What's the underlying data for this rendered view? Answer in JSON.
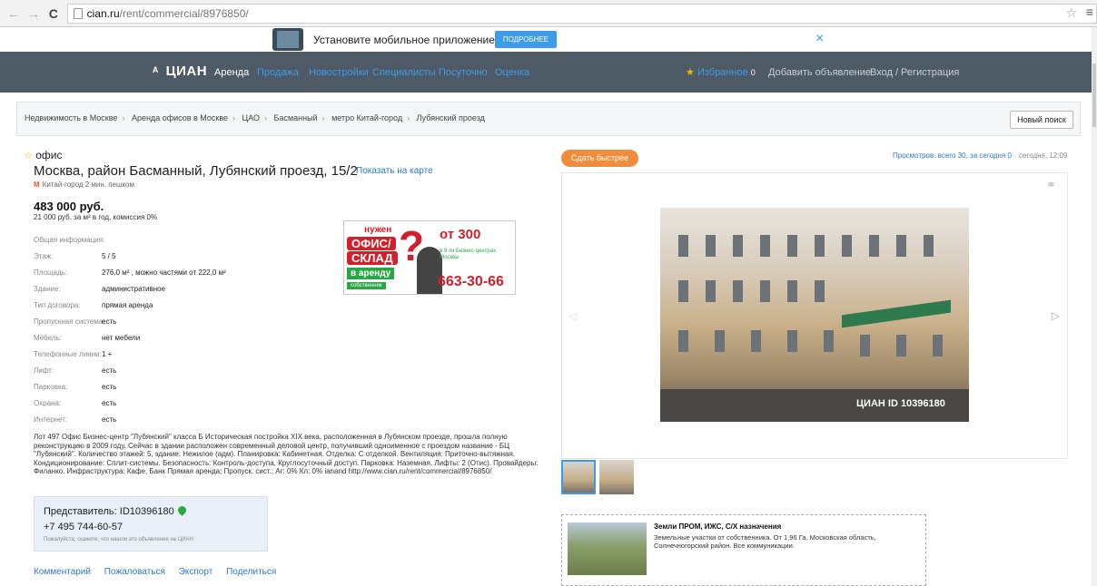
{
  "browser": {
    "url_host": "cian.ru",
    "url_path": "/rent/commercial/8976850/"
  },
  "promo": {
    "text": "Установите мобильное приложение ЦИАН",
    "button": "ПОДРОБНЕЕ",
    "close": "×"
  },
  "nav": {
    "logo": "ЦИАН",
    "items": [
      "Аренда",
      "Продажа",
      "Новостройки",
      "Специалисты",
      "Посуточно",
      "Оценка"
    ],
    "favorites": "Избранное",
    "favorites_count": "0",
    "add_listing": "Добавить объявление",
    "login": "Вход / Регистрация"
  },
  "breadcrumbs": [
    "Недвижимость в Москве",
    "Аренда офисов в Москве",
    "ЦАО",
    "Басманный",
    "метро Китай-город",
    "Лубянский проезд"
  ],
  "new_search": "Новый поиск",
  "listing": {
    "type": "офис",
    "address": "Москва, район Басманный, Лубянский проезд, 15/2",
    "show_on_map": "Показать на карте",
    "metro": "Китай-город 2 мин. пешком",
    "price": "483 000 руб.",
    "price_detail": "21 000 руб. за м² в год, комиссия 0%",
    "params_header": "Общая информация:",
    "params": [
      {
        "key": "Этаж:",
        "value": "5 / 5"
      },
      {
        "key": "Площадь:",
        "value": "276,0 м² , можно частями от 222,0 м²"
      },
      {
        "key": "Здание:",
        "value": "административное"
      },
      {
        "key": "Тип договора:",
        "value": "прямая аренда"
      },
      {
        "key": "Пропускная система:",
        "value": "есть"
      },
      {
        "key": "Мебель:",
        "value": "нет мебели"
      },
      {
        "key": "Телефонные линии:",
        "value": "1 +"
      },
      {
        "key": "Лифт:",
        "value": "есть"
      },
      {
        "key": "Парковка:",
        "value": "есть"
      },
      {
        "key": "Охрана:",
        "value": "есть"
      },
      {
        "key": "Интернет:",
        "value": "есть"
      }
    ],
    "description": "Лот 497 Офис Бизнес-центр \"Лубянский\" класса Б Историческая постройка XIX века, расположенная в Лубянском проезде, прошла полную реконструкцию в 2009 году. Сейчас в здании расположен современный деловой центр, получивший одноименное с проездом название - БЦ \"Лубянский\". Количество этажей: 5, здание: Нежилое (адм). Планировка: Кабинетная. Отделка: С отделкой. Вентиляция: Приточно-вытяжная. Кондиционирование: Сплит-системы. Безопасность: Контроль-доступа, Круглосуточный доступ. Парковка: Наземная. Лифты: 2 (Отис). Провайдеры: Филанко. Инфраструктура: Кафе, Банк Прямая аренда; Пропуск. сист.; Аг: 0% Кл: 0% ianand http://www.cian.ru/rent/commercial/8976850/"
  },
  "banner": {
    "need": "нужен",
    "office": "ОФИС/",
    "warehouse": "СКЛАД",
    "for_rent": "в аренду",
    "owner": "собственник",
    "from": "от 300",
    "centers": "в 9-ти Бизнес-центрах Москвы",
    "phone": "663-30-66"
  },
  "agent": {
    "name": "Представитель: ID10396180",
    "phone": "+7 495 744-60-57",
    "note": "Пожалуйста, скажите, что нашли это объявление на ЦИАН"
  },
  "actions": [
    "Комментарий",
    "Пожаловаться",
    "Экспорт",
    "Поделиться"
  ],
  "side": {
    "sell_faster": "Сдать быстрее",
    "views": "Просмотров: всего 30, за сегодня 0",
    "updated": "сегодня, 12:09",
    "watermark": "ЦИАН ID 10396180"
  },
  "ad": {
    "title": "Земли ПРОМ, ИЖС, С/Х назначения",
    "text": "Земельные участки от собственника. От 1,96 Га. Московская область, Солнечногорский район. Все коммуникации."
  },
  "colors": {
    "nav_bg": "#4e5a65",
    "link": "#2a7ac9",
    "accent_orange": "#f08c3c",
    "promo_button": "#3d9be9"
  }
}
